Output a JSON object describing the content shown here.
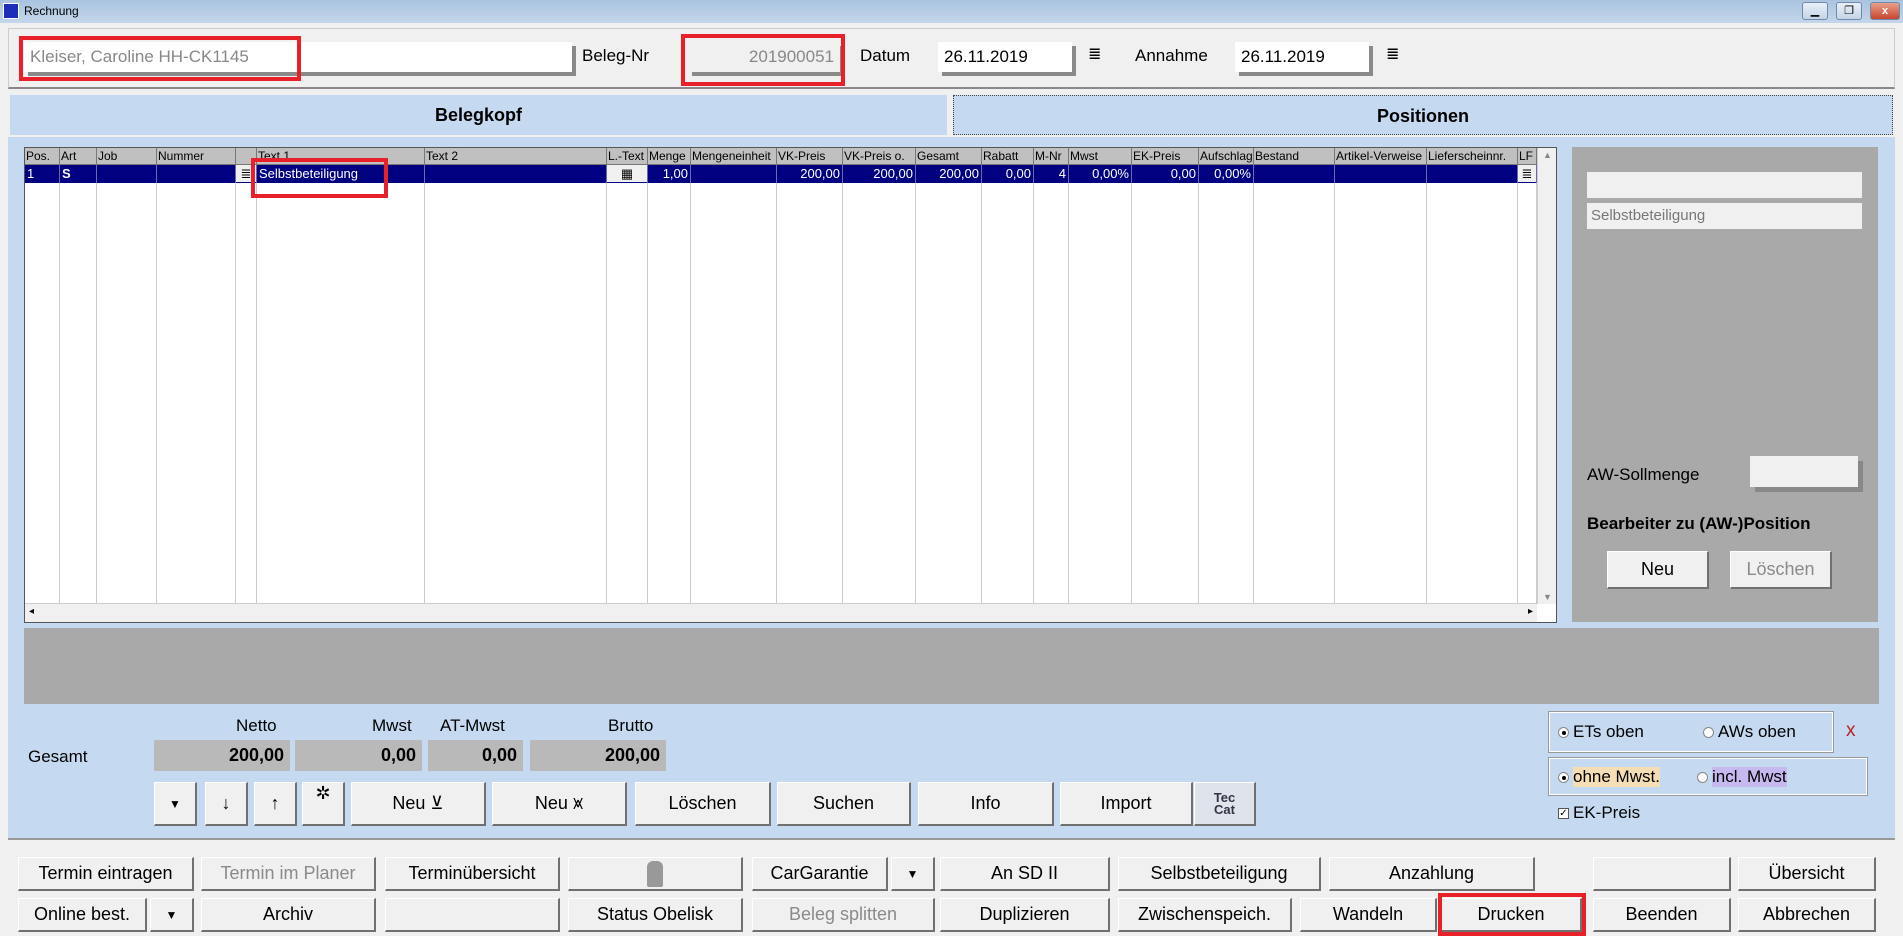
{
  "window": {
    "title": "Rechnung",
    "controls": [
      "minimize",
      "restore",
      "close"
    ]
  },
  "header": {
    "customer": "Kleiser, Caroline HH-CK1145",
    "beleg_label": "Beleg-Nr",
    "beleg_nr": "201900051",
    "datum_label": "Datum",
    "datum": "26.11.2019",
    "annahme_label": "Annahme",
    "annahme": "26.11.2019"
  },
  "tabs": [
    {
      "label": "Belegkopf",
      "active": true
    },
    {
      "label": "Positionen",
      "active": false
    }
  ],
  "grid": {
    "columns": [
      "Pos.",
      "Art",
      "Job",
      "Nummer",
      "",
      "Text 1",
      "Text 2",
      "L.-Text",
      "Menge",
      "Mengeneinheit",
      "VK-Preis",
      "VK-Preis o.",
      "Gesamt",
      "Rabatt",
      "M-Nr",
      "Mwst",
      "EK-Preis",
      "Aufschlag",
      "Bestand",
      "Artikel-Verweise",
      "Lieferscheinnr.",
      "LF"
    ],
    "rows": [
      [
        "1",
        "S",
        "",
        "",
        "",
        "Selbstbeteiligung",
        "",
        "",
        "1,00",
        "",
        "200,00",
        "200,00",
        "200,00",
        "0,00",
        "4",
        "0,00%",
        "0,00",
        "0,00%",
        "",
        "",
        "",
        ""
      ]
    ]
  },
  "right_panel": {
    "field1": "",
    "field2": "Selbstbeteiligung",
    "sollmenge_label": "AW-Sollmenge",
    "sollmenge": "",
    "bearbeiter_label": "Bearbeiter zu (AW-)Position",
    "neu": "Neu",
    "loeschen": "Löschen"
  },
  "totals": {
    "label": "Gesamt",
    "netto_label": "Netto",
    "netto": "200,00",
    "mwst_label": "Mwst",
    "mwst": "0,00",
    "atmwst_label": "AT-Mwst",
    "atmwst": "0,00",
    "brutto_label": "Brutto",
    "brutto": "200,00"
  },
  "toolbar": {
    "neu1": "Neu",
    "neu2": "Neu",
    "loeschen": "Löschen",
    "suchen": "Suchen",
    "info": "Info",
    "import": "Import",
    "teccat": "Tec Cat"
  },
  "options": {
    "ets_oben": "ETs oben",
    "aws_oben": "AWs oben",
    "ohne_mwst": "ohne Mwst.",
    "incl_mwst": "incl. Mwst",
    "ek_preis": "EK-Preis",
    "ek_checked": true,
    "ohne_color": "#f5deb3",
    "incl_color": "#c8b8f0"
  },
  "bottom": {
    "row1": [
      "Termin eintragen",
      "Termin im Planer",
      "Terminübersicht",
      "",
      "CarGarantie",
      "",
      "An SD II",
      "Selbstbeteiligung",
      "Anzahlung",
      "",
      "Übersicht"
    ],
    "row2": [
      "Online best.",
      "",
      "Archiv",
      "",
      "Status Obelisk",
      "Beleg splitten",
      "Duplizieren",
      "Zwischenspeich.",
      "Wandeln",
      "Drucken",
      "Beenden",
      "Abbrechen"
    ]
  }
}
